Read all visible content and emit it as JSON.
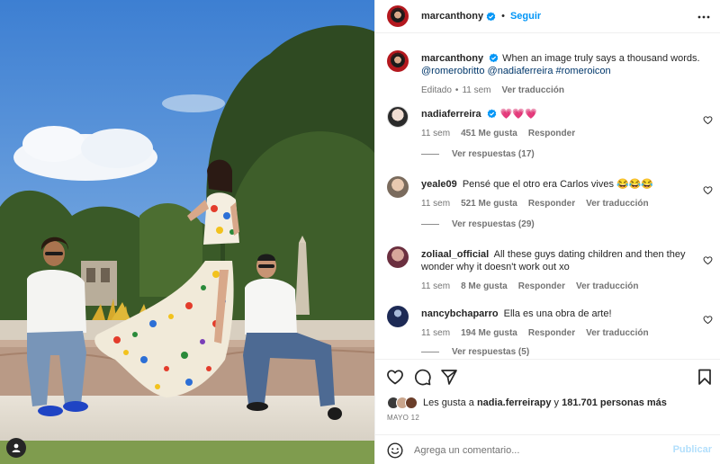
{
  "post": {
    "author": "marcanthony",
    "follow_label": "Seguir",
    "dot": "•"
  },
  "caption": {
    "username": "marcanthony",
    "text": "When an image truly says a thousand words.",
    "mentions": [
      "@romerobritto",
      "@nadiaferreira",
      "#romeroicon"
    ],
    "edited_label": "Editado",
    "time": "11 sem",
    "translate_label": "Ver traducción"
  },
  "comments": [
    {
      "username": "nadiaferreira",
      "text": "💗💗💗",
      "time": "11 sem",
      "likes": "451 Me gusta",
      "reply_label": "Responder",
      "translate_label": "",
      "replies_label": "Ver respuestas (17)"
    },
    {
      "username": "yeale09",
      "text": "Pensé que el otro era Carlos vives 😂😂😂",
      "time": "11 sem",
      "likes": "521 Me gusta",
      "reply_label": "Responder",
      "translate_label": "Ver traducción",
      "replies_label": "Ver respuestas (29)"
    },
    {
      "username": "zoliaal_official",
      "text": "All these guys dating children and then they wonder why it doesn't work out xo",
      "time": "11 sem",
      "likes": "8 Me gusta",
      "reply_label": "Responder",
      "translate_label": "Ver traducción",
      "replies_label": ""
    },
    {
      "username": "nancybchaparro",
      "text": "Ella es una obra de arte!",
      "time": "11 sem",
      "likes": "194 Me gusta",
      "reply_label": "Responder",
      "translate_label": "Ver traducción",
      "replies_label": "Ver respuestas (5)"
    }
  ],
  "likes": {
    "prefix": "Les gusta a",
    "first_user": "nadia.ferreirapy",
    "connector": "y",
    "others": "181.701 personas más"
  },
  "date": "MAYO 12",
  "comment_input": {
    "placeholder": "Agrega un comentario...",
    "post_label": "Publicar"
  },
  "colors": {
    "accent": "#0095f6",
    "link": "#00376b",
    "verified": "#0095f6",
    "muted": "#737373"
  },
  "icons": [
    "user-tag-icon",
    "verified-icon",
    "more-icon",
    "heart-icon",
    "comment-icon",
    "share-icon",
    "bookmark-icon",
    "emoji-icon"
  ]
}
